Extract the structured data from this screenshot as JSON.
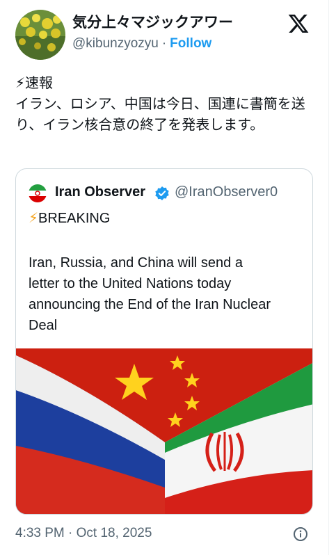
{
  "author": {
    "display_name": "気分上々マジックアワー",
    "handle": "@kibunzyozyu",
    "separator": "·",
    "follow_label": "Follow"
  },
  "tweet": {
    "text": "⚡速報\nイラン、ロシア、中国は今日、国連に書簡を送り、イラン核合意の終了を発表します。"
  },
  "quote": {
    "name": "Iran Observer",
    "handle": "@IranObserver0",
    "breaking_label": "BREAKING",
    "breaking_icon": "lightning-bolt",
    "body": "Iran, Russia, and China will send a\nletter to the United Nations today\nannouncing the End of the Iran Nuclear\nDeal",
    "image_description": "flags-of-china-russia-iran"
  },
  "footer": {
    "timestamp": "4:33 PM · Oct 18, 2025"
  },
  "colors": {
    "link_blue": "#1d9bf0",
    "muted": "#536471",
    "border": "#cfd9de",
    "text": "#0f1419"
  }
}
